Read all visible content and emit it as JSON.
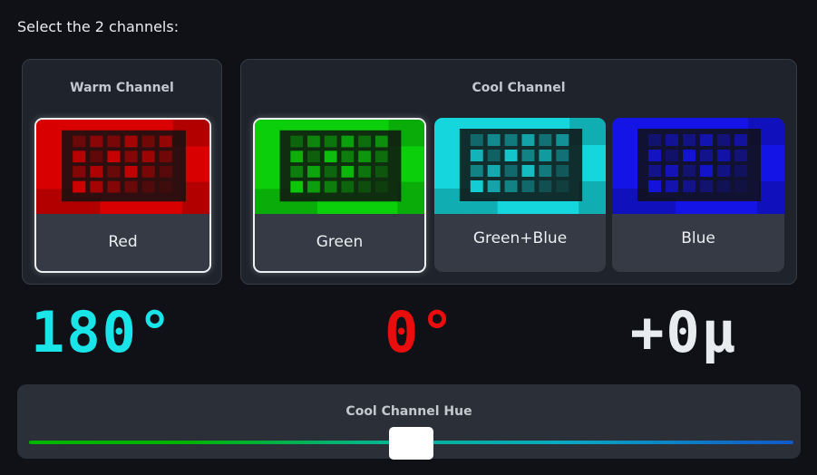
{
  "prompt": "Select the 2 channels:",
  "warm": {
    "title": "Warm Channel",
    "options": [
      {
        "label": "Red",
        "selected": true,
        "tint": "#d80000",
        "dark": "#6e0000"
      }
    ]
  },
  "cool": {
    "title": "Cool Channel",
    "options": [
      {
        "label": "Green",
        "selected": true,
        "tint": "#0ccf0c",
        "dark": "#066a06"
      },
      {
        "label": "Green+Blue",
        "selected": false,
        "tint": "#14d6dc",
        "dark": "#0a6468"
      },
      {
        "label": "Blue",
        "selected": false,
        "tint": "#1414e6",
        "dark": "#08086e"
      }
    ]
  },
  "readouts": {
    "hue": "180°",
    "mid": "0°",
    "right": "+0µ"
  },
  "colors": {
    "hue_readout": "#19e4e8",
    "mid_readout": "#ea0d0d",
    "right_readout": "#e8ecef",
    "background": "#0f1117",
    "panel": "#1f232b"
  },
  "slider": {
    "label": "Cool Channel Hue",
    "value": 0.5
  }
}
